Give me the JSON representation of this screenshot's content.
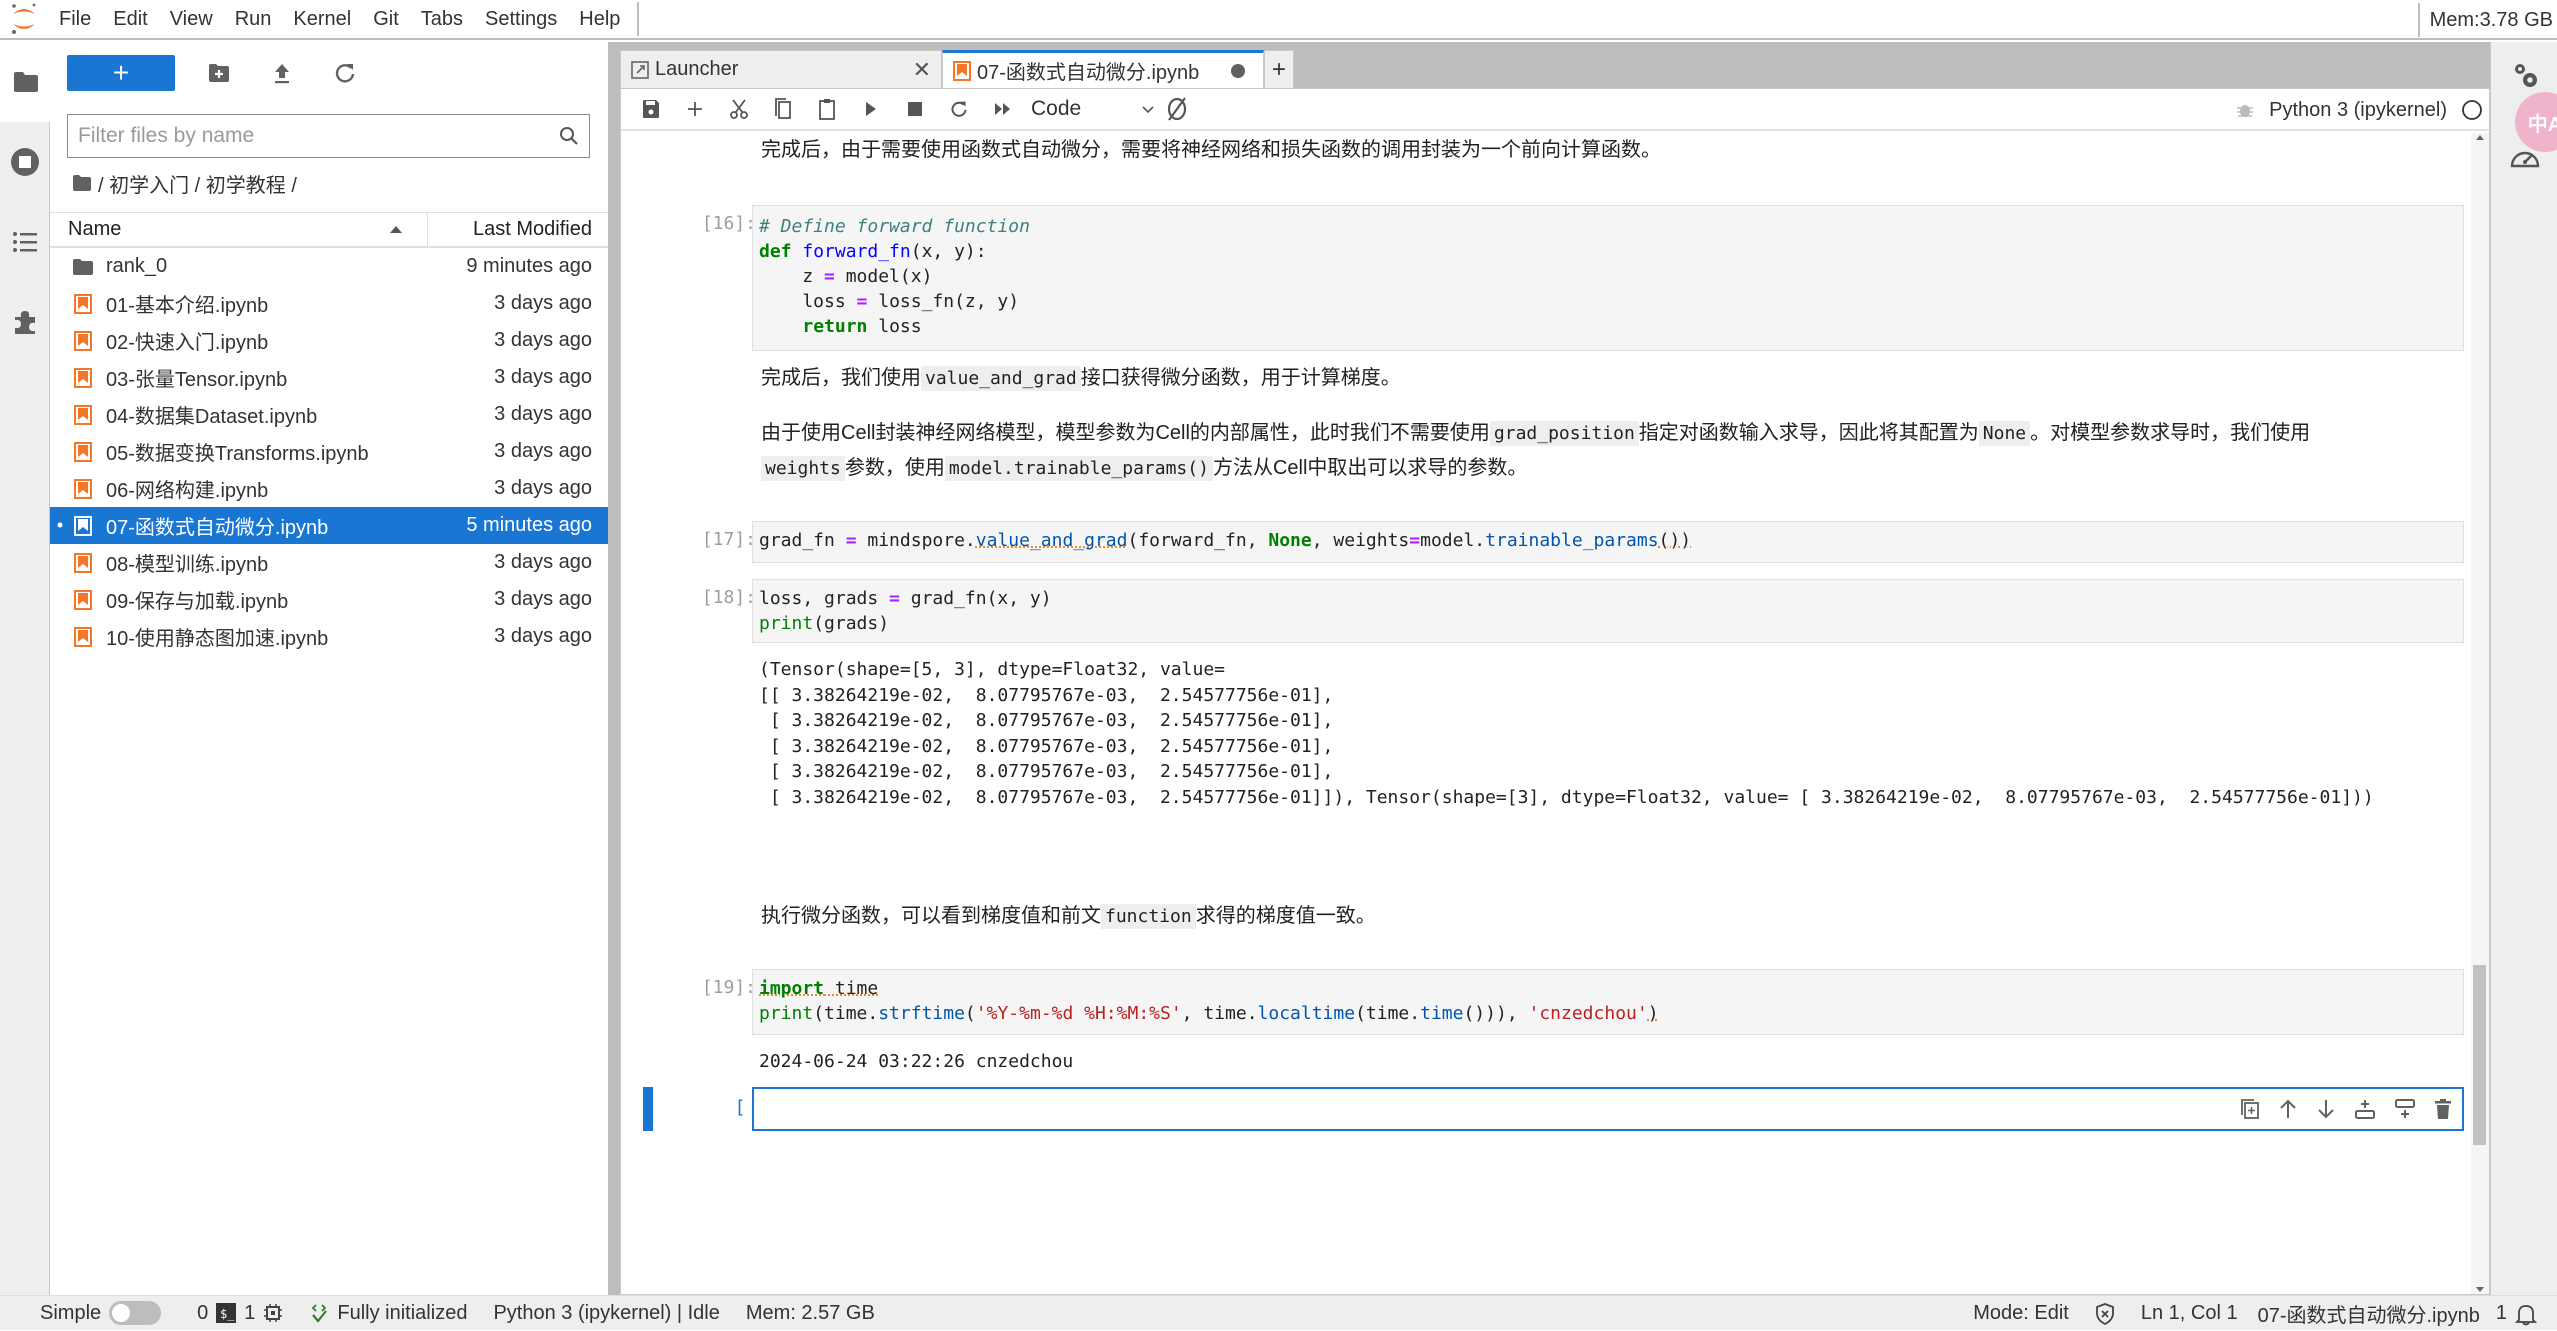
{
  "menubar": {
    "items": [
      "File",
      "Edit",
      "View",
      "Run",
      "Kernel",
      "Git",
      "Tabs",
      "Settings",
      "Help"
    ],
    "memory": "Mem:3.78 GB"
  },
  "activity_bar": {
    "icons": [
      "folder-icon",
      "running-terminals-icon",
      "table-of-contents-icon",
      "extensions-icon"
    ]
  },
  "file_browser": {
    "new_button_label": "+",
    "filter_placeholder": "Filter files by name",
    "filter_value": "",
    "breadcrumb": "/ 初学入门 / 初学教程 /",
    "columns": {
      "name": "Name",
      "modified": "Last Modified"
    },
    "files": [
      {
        "name": "rank_0",
        "type": "folder",
        "modified": "9 minutes ago",
        "selected": false
      },
      {
        "name": "01-基本介绍.ipynb",
        "type": "notebook",
        "modified": "3 days ago",
        "selected": false
      },
      {
        "name": "02-快速入门.ipynb",
        "type": "notebook",
        "modified": "3 days ago",
        "selected": false
      },
      {
        "name": "03-张量Tensor.ipynb",
        "type": "notebook",
        "modified": "3 days ago",
        "selected": false
      },
      {
        "name": "04-数据集Dataset.ipynb",
        "type": "notebook",
        "modified": "3 days ago",
        "selected": false
      },
      {
        "name": "05-数据变换Transforms.ipynb",
        "type": "notebook",
        "modified": "3 days ago",
        "selected": false
      },
      {
        "name": "06-网络构建.ipynb",
        "type": "notebook",
        "modified": "3 days ago",
        "selected": false
      },
      {
        "name": "07-函数式自动微分.ipynb",
        "type": "notebook",
        "modified": "5 minutes ago",
        "selected": true
      },
      {
        "name": "08-模型训练.ipynb",
        "type": "notebook",
        "modified": "3 days ago",
        "selected": false
      },
      {
        "name": "09-保存与加载.ipynb",
        "type": "notebook",
        "modified": "3 days ago",
        "selected": false
      },
      {
        "name": "10-使用静态图加速.ipynb",
        "type": "notebook",
        "modified": "3 days ago",
        "selected": false
      }
    ]
  },
  "tabs": [
    {
      "label": "Launcher",
      "active": false
    },
    {
      "label": "07-函数式自动微分.ipynb",
      "active": true,
      "unsaved": true
    }
  ],
  "notebook_toolbar": {
    "cell_type": "Code",
    "kernel": "Python 3 (ipykernel)"
  },
  "notebook": {
    "md1": "完成后，由于需要使用函数式自动微分，需要将神经网络和损失函数的调用封装为一个前向计算函数。",
    "cell16": {
      "prompt": "[16]:",
      "lines": [
        "# Define forward function",
        "def forward_fn(x, y):",
        "    z = model(x)",
        "    loss = loss_fn(z, y)",
        "    return loss"
      ]
    },
    "md2": {
      "before": "完成后，我们使用",
      "code": "value_and_grad",
      "after": "接口获得微分函数，用于计算梯度。"
    },
    "md3": {
      "p1": "由于使用Cell封装神经网络模型，模型参数为Cell的内部属性，此时我们不需要使用",
      "c1": "grad_position",
      "p2": "指定对函数输入求导，因此将其配置为",
      "c2": "None",
      "p3": "。对模型参数求导时，我们使用",
      "c3": "weights",
      "p4": "参数，使用",
      "c4": "model.trainable_params()",
      "p5": "方法从Cell中取出可以求导的参数。"
    },
    "cell17": {
      "prompt": "[17]:",
      "code": "grad_fn = mindspore.value_and_grad(forward_fn, None, weights=model.trainable_params())"
    },
    "cell18": {
      "prompt": "[18]:",
      "lines": [
        "loss, grads = grad_fn(x, y)",
        "print(grads)"
      ],
      "output": "(Tensor(shape=[5, 3], dtype=Float32, value=\n[[ 3.38264219e-02,  8.07795767e-03,  2.54577756e-01],\n [ 3.38264219e-02,  8.07795767e-03,  2.54577756e-01],\n [ 3.38264219e-02,  8.07795767e-03,  2.54577756e-01],\n [ 3.38264219e-02,  8.07795767e-03,  2.54577756e-01],\n [ 3.38264219e-02,  8.07795767e-03,  2.54577756e-01]]), Tensor(shape=[3], dtype=Float32, value= [ 3.38264219e-02,  8.07795767e-03,  2.54577756e-01]))"
    },
    "md4": {
      "before": "执行微分函数，可以看到梯度值和前文",
      "code": "function",
      "after": "求得的梯度值一致。"
    },
    "cell19": {
      "prompt": "[19]:",
      "lines": [
        "import time",
        "print(time.strftime('%Y-%m-%d %H:%M:%S', time.localtime(time.time())), 'cnzedchou')"
      ],
      "output": "2024-06-24 03:22:26 cnzedchou"
    },
    "active_cell": {
      "prompt": "[ ]:",
      "value": ""
    }
  },
  "statusbar": {
    "simple_label": "Simple",
    "simple_on": false,
    "terminals": "0",
    "kernels": "1",
    "lsp_status": "Fully initialized",
    "kernel_status": "Python 3 (ipykernel) | Idle",
    "memory": "Mem: 2.57 GB",
    "mode": "Mode: Edit",
    "cursor": "Ln 1, Col 1",
    "filename": "07-函数式自动微分.ipynb",
    "notifications": "1"
  },
  "colors": {
    "accent": "#1976d2",
    "notebook_icon": "#f37726"
  }
}
